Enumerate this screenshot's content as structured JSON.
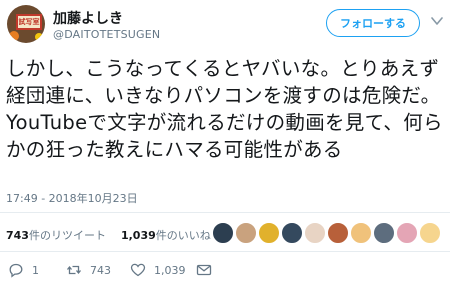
{
  "user": {
    "display_name": "加藤よしき",
    "handle": "@DAITOTETSUGEN",
    "avatar_sign": "試写室"
  },
  "follow_button_label": "フォローする",
  "tweet": {
    "text": "しかし、こうなってくるとヤバいな。とりあえず経団連に、いきなりパソコンを渡すのは危険だ。YouTubeで文字が流れるだけの動画を見て、何らかの狂った教えにハマる可能性がある",
    "timestamp": "17:49 - 2018年10月23日"
  },
  "stats": {
    "retweets_count": "743",
    "retweets_label": "件のリツイート",
    "likes_count": "1,039",
    "likes_label": "件のいいね"
  },
  "likers": [
    {
      "color": "#2c3e50"
    },
    {
      "color": "#c9a27e"
    },
    {
      "color": "#e1b12c"
    },
    {
      "color": "#34495e"
    },
    {
      "color": "#e8d4c4"
    },
    {
      "color": "#b8603a"
    },
    {
      "color": "#f0c27b"
    },
    {
      "color": "#5d6d7e"
    },
    {
      "color": "#e4a5b5"
    },
    {
      "color": "#f6d58e"
    }
  ],
  "actions": {
    "reply_count": "1",
    "retweet_count": "743",
    "like_count": "1,039"
  },
  "colors": {
    "accent": "#1da1f2",
    "secondary_text": "#657786"
  }
}
